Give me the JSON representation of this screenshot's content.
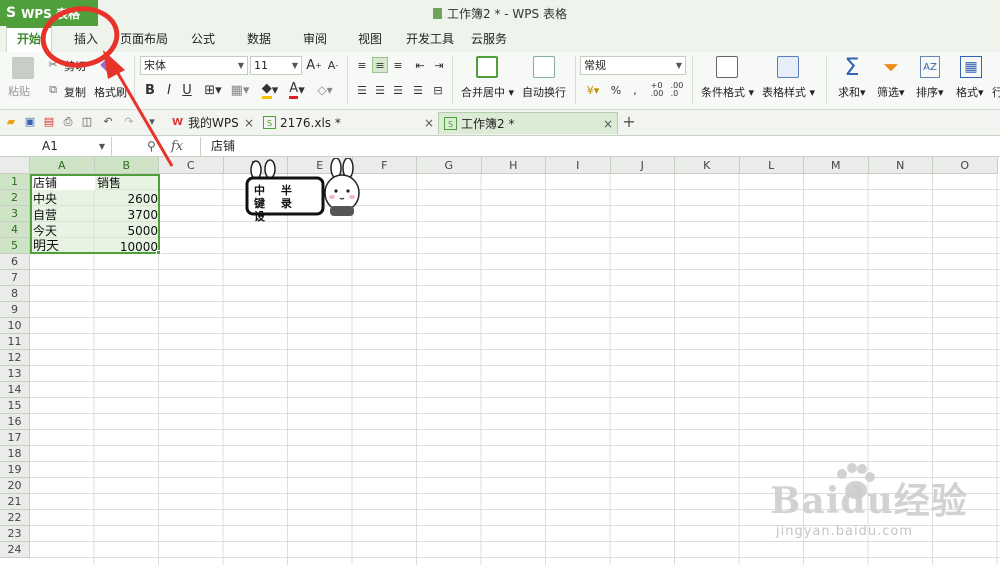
{
  "titlebar": {
    "app_name": "WPS 表格",
    "title": "工作簿2 * - WPS 表格"
  },
  "ribbon_tabs": [
    "开始",
    "插入",
    "页面布局",
    "公式",
    "数据",
    "审阅",
    "视图",
    "开发工具",
    "云服务"
  ],
  "active_tab": "开始",
  "ribbon": {
    "paste": "粘贴",
    "cut": "剪切",
    "copy": "复制",
    "format_painter": "格式刷",
    "font_name": "宋体",
    "font_size": "11",
    "bold": "B",
    "italic": "I",
    "underline": "U",
    "merge_center": "合并居中",
    "wrap_text": "自动换行",
    "number_format": "常规",
    "percent": "%",
    "conditional_format": "条件格式",
    "table_style": "表格样式",
    "sum": "求和",
    "filter": "筛选",
    "sort": "排序",
    "format": "格式",
    "more": "行"
  },
  "doc_tabs": [
    {
      "label": "我的WPS"
    },
    {
      "label": "2176.xls *"
    },
    {
      "label": "工作簿2 *"
    }
  ],
  "formula_bar": {
    "name_box": "A1",
    "fx": "fx",
    "content": "店铺"
  },
  "columns": [
    "A",
    "B",
    "C",
    "D",
    "E",
    "F",
    "G",
    "H",
    "I",
    "J",
    "K",
    "L",
    "M",
    "N",
    "O"
  ],
  "rows": [
    "1",
    "2",
    "3",
    "4",
    "5",
    "6",
    "7",
    "8",
    "9",
    "10",
    "11",
    "12",
    "13",
    "14",
    "15",
    "16",
    "17",
    "18",
    "19",
    "20",
    "21",
    "22",
    "23",
    "24"
  ],
  "sheet": {
    "header": [
      "店铺",
      "销售"
    ],
    "data": [
      [
        "中央",
        "2600"
      ],
      [
        "自营",
        "3700"
      ],
      [
        "今天",
        "5000"
      ],
      [
        "明天",
        "10000"
      ]
    ]
  },
  "sticker": {
    "text": "中 半 键 录 设"
  },
  "watermark": {
    "brand": "Baidu经验",
    "url": "jingyan.baidu.com"
  },
  "colors": {
    "accent": "#4f9f3a",
    "annotation": "#e8332b",
    "selection": "#d6e9ce"
  }
}
